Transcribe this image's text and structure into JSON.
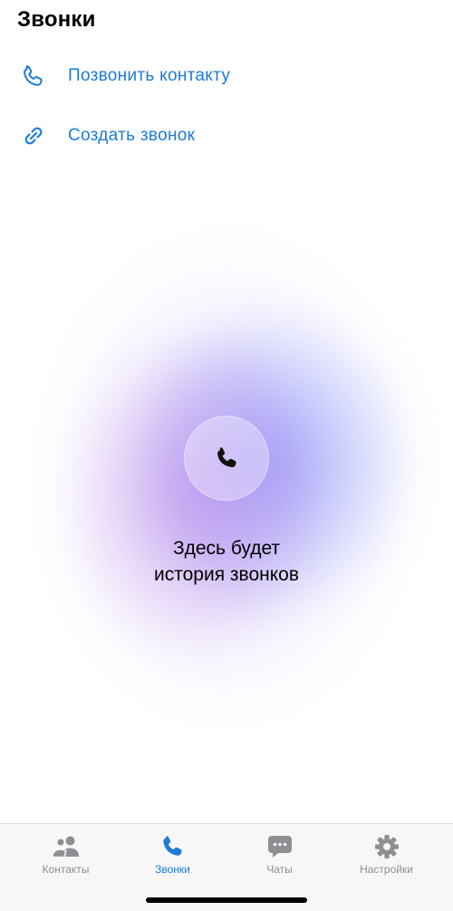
{
  "header": {
    "title": "Звонки"
  },
  "actions": [
    {
      "label": "Позвонить контакту",
      "icon": "phone-outline-icon"
    },
    {
      "label": "Создать звонок",
      "icon": "link-icon"
    }
  ],
  "empty_state": {
    "line1": "Здесь будет",
    "line2": "история звонков",
    "icon": "phone-icon"
  },
  "tab_bar": {
    "tabs": [
      {
        "label": "Контакты",
        "icon": "contacts-icon",
        "active": false
      },
      {
        "label": "Звонки",
        "icon": "phone-icon",
        "active": true
      },
      {
        "label": "Чаты",
        "icon": "chat-bubble-icon",
        "active": false
      },
      {
        "label": "Настройки",
        "icon": "gear-icon",
        "active": false
      }
    ]
  },
  "colors": {
    "accent": "#1b7bd6",
    "inactive": "#8e8e93",
    "glow_purple": "#be82e6",
    "glow_blue": "#7882fa"
  }
}
